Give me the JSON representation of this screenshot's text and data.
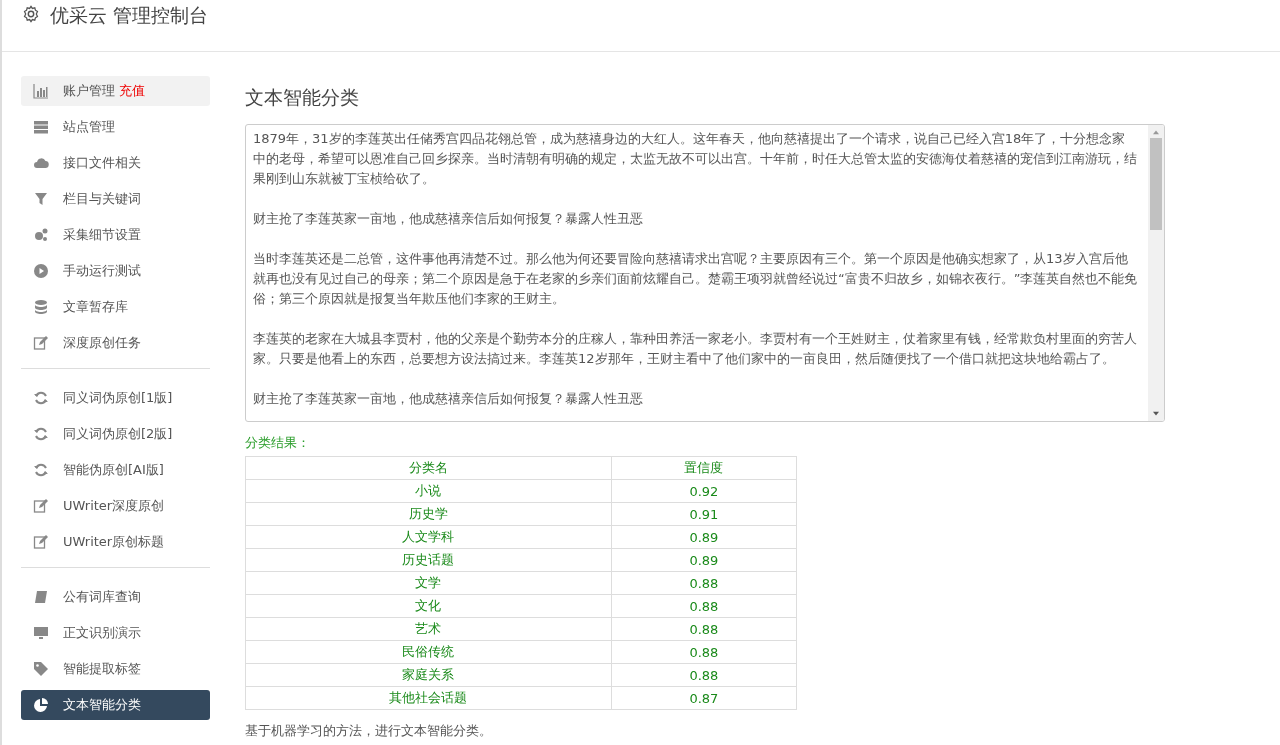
{
  "header": {
    "title": "优采云 管理控制台"
  },
  "sidebar": {
    "groups": [
      {
        "items": [
          {
            "label": "账户管理",
            "badge": "充值",
            "selected": false,
            "hover": true
          },
          {
            "label": "站点管理",
            "selected": false,
            "hover": false
          },
          {
            "label": "接口文件相关",
            "selected": false,
            "hover": false
          },
          {
            "label": "栏目与关键词",
            "selected": false,
            "hover": false
          },
          {
            "label": "采集细节设置",
            "selected": false,
            "hover": false
          },
          {
            "label": "手动运行测试",
            "selected": false,
            "hover": false
          },
          {
            "label": "文章暂存库",
            "selected": false,
            "hover": false
          },
          {
            "label": "深度原创任务",
            "selected": false,
            "hover": false
          }
        ]
      },
      {
        "items": [
          {
            "label": "同义词伪原创[1版]",
            "selected": false,
            "hover": false
          },
          {
            "label": "同义词伪原创[2版]",
            "selected": false,
            "hover": false
          },
          {
            "label": "智能伪原创[AI版]",
            "selected": false,
            "hover": false
          },
          {
            "label": "UWriter深度原创",
            "selected": false,
            "hover": false
          },
          {
            "label": "UWriter原创标题",
            "selected": false,
            "hover": false
          }
        ]
      },
      {
        "items": [
          {
            "label": "公有词库查询",
            "selected": false,
            "hover": false
          },
          {
            "label": "正文识别演示",
            "selected": false,
            "hover": false
          },
          {
            "label": "智能提取标签",
            "selected": false,
            "hover": false
          },
          {
            "label": "文本智能分类",
            "selected": true,
            "hover": false
          }
        ]
      }
    ]
  },
  "main": {
    "title": "文本智能分类",
    "text": [
      "1879年，31岁的李莲英出任储秀宫四品花翎总管，成为慈禧身边的大红人。这年春天，他向慈禧提出了一个请求，说自己已经入宫18年了，十分想念家中的老母，希望可以恩准自己回乡探亲。当时清朝有明确的规定，太监无故不可以出宫。十年前，时任大总管太监的安德海仗着慈禧的宠信到江南游玩，结果刚到山东就被丁宝桢给砍了。",
      "财主抢了李莲英家一亩地，他成慈禧亲信后如何报复？暴露人性丑恶",
      "当时李莲英还是二总管，这件事他再清楚不过。那么他为何还要冒险向慈禧请求出宫呢？主要原因有三个。第一个原因是他确实想家了，从13岁入宫后他就再也没有见过自己的母亲；第二个原因是急于在老家的乡亲们面前炫耀自己。楚霸王项羽就曾经说过“富贵不归故乡，如锦衣夜行。”李莲英自然也不能免俗；第三个原因就是报复当年欺压他们李家的王财主。",
      "李莲英的老家在大城县李贾村，他的父亲是个勤劳本分的庄稼人，靠种田养活一家老小。李贾村有一个王姓财主，仗着家里有钱，经常欺负村里面的穷苦人家。只要是他看上的东西，总要想方设法搞过来。李莲英12岁那年，王财主看中了他们家中的一亩良田，然后随便找了一个借口就把这块地给霸占了。",
      "财主抢了李莲英家一亩地，他成慈禧亲信后如何报复？暴露人性丑恶"
    ],
    "result_label": "分类结果：",
    "table": {
      "columns": [
        "分类名",
        "置信度"
      ],
      "rows": [
        [
          "小说",
          "0.92"
        ],
        [
          "历史学",
          "0.91"
        ],
        [
          "人文学科",
          "0.89"
        ],
        [
          "历史话题",
          "0.89"
        ],
        [
          "文学",
          "0.88"
        ],
        [
          "文化",
          "0.88"
        ],
        [
          "艺术",
          "0.88"
        ],
        [
          "民俗传统",
          "0.88"
        ],
        [
          "家庭关系",
          "0.88"
        ],
        [
          "其他社会话题",
          "0.87"
        ]
      ]
    },
    "note": "基于机器学习的方法，进行文本智能分类。"
  }
}
